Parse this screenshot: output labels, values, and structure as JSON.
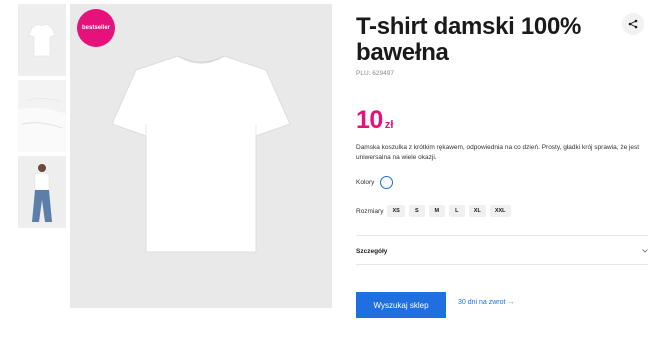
{
  "gallery": {
    "badge": "bestseller"
  },
  "product": {
    "title": "T-shirt damski 100% bawełna",
    "plu": "PLU: 629497",
    "price_value": "10",
    "price_currency": "zł",
    "description": "Damska koszulka z krótkim rękawem, odpowiednia na co dzień. Prosty, gładki krój sprawia, że jest uniwersalna na wiele okazji."
  },
  "options": {
    "colors_label": "Kolory",
    "sizes_label": "Rozmiary",
    "sizes": [
      "XS",
      "S",
      "M",
      "L",
      "XL",
      "XXL"
    ]
  },
  "details": {
    "label": "Szczegóły"
  },
  "actions": {
    "find_store": "Wyszukaj sklep",
    "returns": "30 dni na zwrot →"
  },
  "colors": {
    "accent_pink": "#e6117a",
    "accent_blue": "#1f6fe0"
  }
}
